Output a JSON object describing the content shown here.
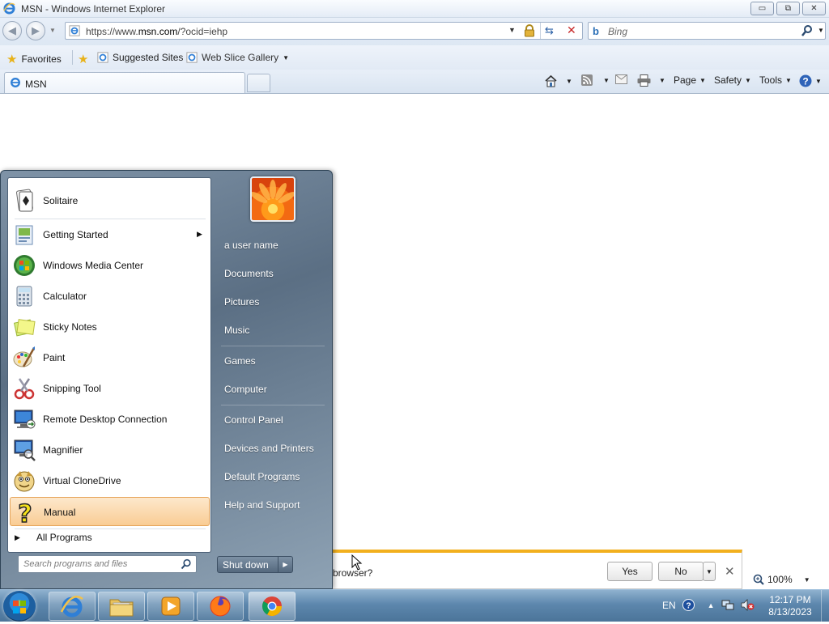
{
  "window": {
    "title": "MSN - Windows Internet Explorer",
    "minimize_glyph": "▭",
    "maximize_glyph": "⧉",
    "close_glyph": "✕"
  },
  "address_bar": {
    "url_prefix": "https://www.",
    "url_domain": "msn.com",
    "url_suffix": "/?ocid=iehp"
  },
  "search_bar": {
    "placeholder": "Bing"
  },
  "favorites_bar": {
    "favorites_label": "Favorites",
    "suggested_sites": "Suggested Sites",
    "web_slice_gallery": "Web Slice Gallery"
  },
  "tabs": [
    {
      "title": "MSN"
    }
  ],
  "command_bar": {
    "page": "Page",
    "safety": "Safety",
    "tools": "Tools"
  },
  "notification": {
    "message": "browser?",
    "yes_label": "Yes",
    "no_label": "No"
  },
  "zoom": {
    "level": "100%"
  },
  "start_menu": {
    "programs": [
      {
        "label": "Solitaire",
        "icon": "solitaire-icon"
      },
      {
        "label": "Getting Started",
        "icon": "getting-started-icon",
        "submenu": true
      },
      {
        "label": "Windows Media Center",
        "icon": "media-center-icon"
      },
      {
        "label": "Calculator",
        "icon": "calculator-icon"
      },
      {
        "label": "Sticky Notes",
        "icon": "sticky-notes-icon"
      },
      {
        "label": "Paint",
        "icon": "paint-icon"
      },
      {
        "label": "Snipping Tool",
        "icon": "snipping-tool-icon"
      },
      {
        "label": "Remote Desktop Connection",
        "icon": "remote-desktop-icon"
      },
      {
        "label": "Magnifier",
        "icon": "magnifier-icon"
      },
      {
        "label": "Virtual CloneDrive",
        "icon": "clonedrive-icon"
      },
      {
        "label": "Manual",
        "icon": "help-question-icon",
        "highlighted": true
      }
    ],
    "all_programs": "All Programs",
    "search_placeholder": "Search programs and files",
    "user_name": "a user name",
    "right_items": [
      "Documents",
      "Pictures",
      "Music",
      "Games",
      "Computer",
      "Control Panel",
      "Devices and Printers",
      "Default Programs",
      "Help and Support"
    ],
    "shutdown_label": "Shut down"
  },
  "taskbar": {
    "language": "EN",
    "time": "12:17 PM",
    "date": "8/13/2023",
    "pinned": [
      "internet-explorer-icon",
      "file-explorer-icon",
      "media-player-icon",
      "firefox-icon",
      "chrome-icon"
    ]
  },
  "colors": {
    "notification_accent": "#f2b01e",
    "highlight": "#f9cc94",
    "taskbar": "#5d87ad"
  }
}
